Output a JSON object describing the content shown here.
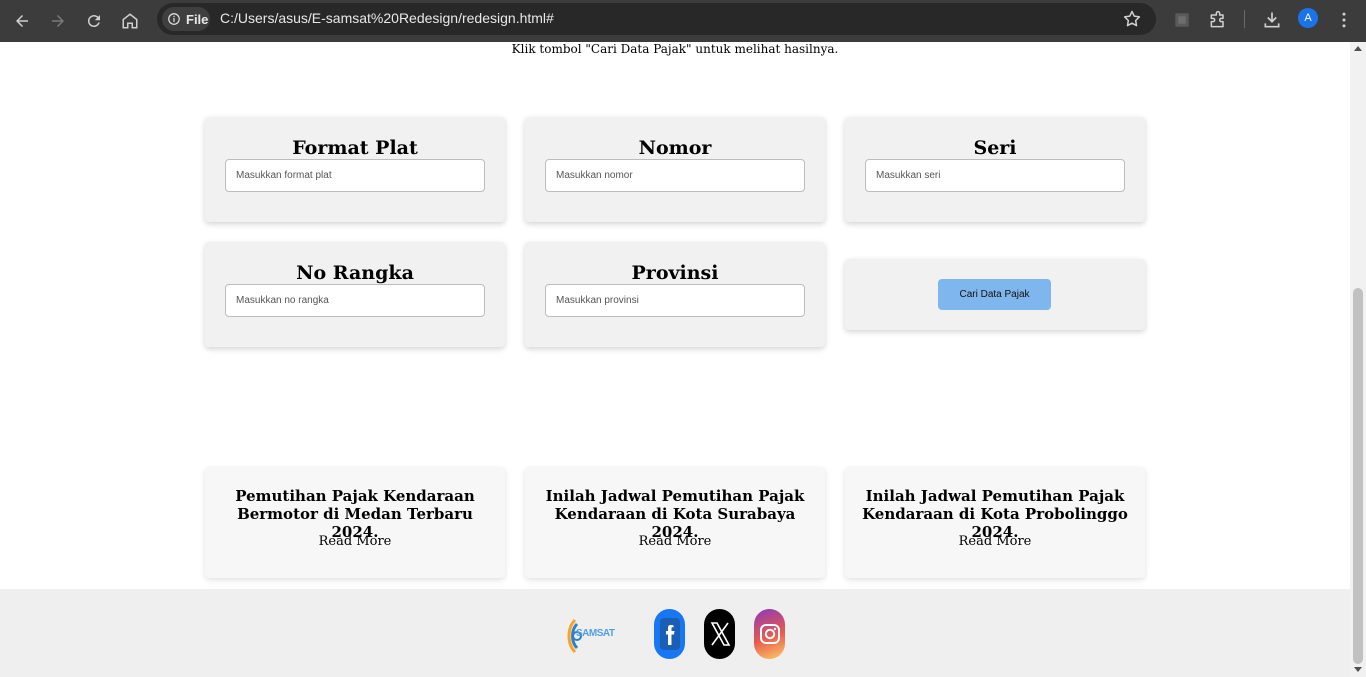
{
  "browser": {
    "chip_label": "File",
    "url": "C:/Users/asus/E-samsat%20Redesign/redesign.html#",
    "avatar_letter": "A"
  },
  "page": {
    "instruction": "Klik tombol \"Cari Data Pajak\" untuk melihat hasilnya."
  },
  "form": {
    "fields": [
      {
        "title": "Format Plat",
        "placeholder": "Masukkan format plat"
      },
      {
        "title": "Nomor",
        "placeholder": "Masukkan nomor"
      },
      {
        "title": "Seri",
        "placeholder": "Masukkan seri"
      },
      {
        "title": "No Rangka",
        "placeholder": "Masukkan no rangka"
      },
      {
        "title": "Provinsi",
        "placeholder": "Masukkan provinsi"
      }
    ],
    "search_button": "Cari Data Pajak"
  },
  "news": [
    {
      "title": "Pemutihan Pajak Kendaraan Bermotor di Medan Terbaru 2024.",
      "link": "Read More"
    },
    {
      "title": "Inilah Jadwal Pemutihan Pajak Kendaraan di Kota Surabaya 2024.",
      "link": "Read More"
    },
    {
      "title": "Inilah Jadwal Pemutihan Pajak Kendaraan di Kota Probolinggo 2024.",
      "link": "Read More"
    }
  ],
  "footer": {
    "logo_text": "SAMSAT",
    "social": [
      {
        "icon": "facebook-icon",
        "color": "#1877f2"
      },
      {
        "icon": "x-icon",
        "color": "#000000"
      },
      {
        "icon": "instagram-icon",
        "color": "#d6249f"
      }
    ]
  },
  "colors": {
    "chrome_bg": "#3c3c3c",
    "card_bg": "#f1f1f1",
    "button_bg": "#7fb6ee",
    "footer_bg": "#efefef"
  }
}
